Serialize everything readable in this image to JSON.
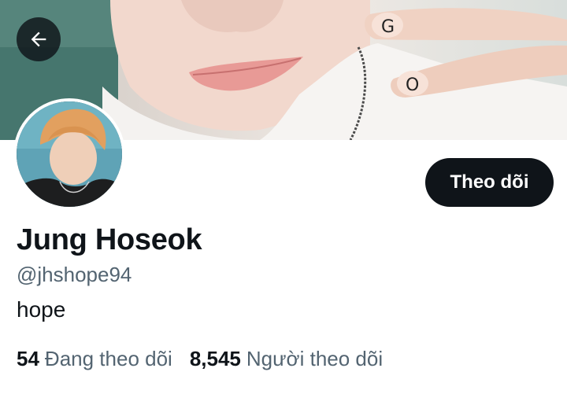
{
  "profile": {
    "display_name": "Jung Hoseok",
    "handle": "@jhshope94",
    "bio": "hope",
    "follow_button_label": "Theo dõi"
  },
  "stats": {
    "following_count": "54",
    "following_label": "Đang theo dõi",
    "followers_count": "8,545",
    "followers_label": "Người theo dõi"
  },
  "banner": {
    "finger_letter_1": "G",
    "finger_letter_2": "O"
  },
  "icons": {
    "back": "arrow-left-icon"
  },
  "colors": {
    "button_dark": "#0f1419",
    "secondary_text": "#536471"
  }
}
